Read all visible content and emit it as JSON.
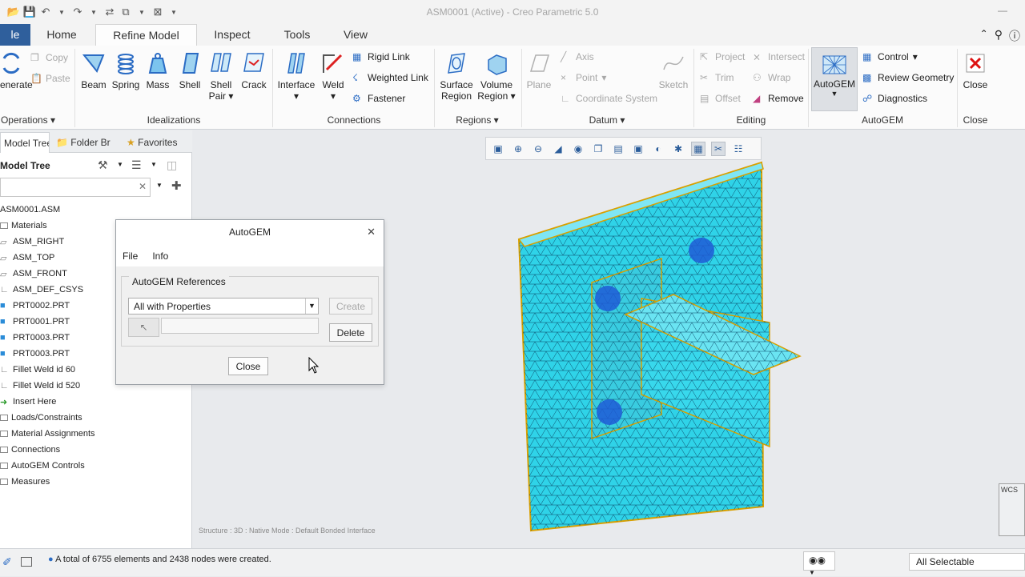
{
  "window": {
    "title": "ASM0001 (Active) - Creo Parametric 5.0"
  },
  "qat": {
    "icons": [
      "open-icon",
      "save-icon",
      "undo-icon",
      "redo-icon",
      "regenerate-icon",
      "windows-icon",
      "close-window-icon",
      "customize-icon"
    ]
  },
  "tabs": [
    {
      "label": "le"
    },
    {
      "label": "Home"
    },
    {
      "label": "Refine Model"
    },
    {
      "label": "Inspect"
    },
    {
      "label": "Tools"
    },
    {
      "label": "View"
    }
  ],
  "ribbon": {
    "operations": {
      "regen_label": "enerate",
      "copy": "Copy",
      "paste": "Paste",
      "group": "Operations"
    },
    "idealizations": {
      "beam": "Beam",
      "spring": "Spring",
      "mass": "Mass",
      "shell": "Shell",
      "shell_pair_1": "Shell",
      "shell_pair_2": "Pair",
      "crack": "Crack",
      "group": "Idealizations"
    },
    "connections": {
      "interface": "Interface",
      "weld": "Weld",
      "rigid_link": "Rigid Link",
      "weighted_link": "Weighted Link",
      "fastener": "Fastener",
      "group": "Connections"
    },
    "regions": {
      "surface_1": "Surface",
      "surface_2": "Region",
      "volume_1": "Volume",
      "volume_2": "Region",
      "group": "Regions"
    },
    "datum": {
      "plane": "Plane",
      "axis": "Axis",
      "point": "Point",
      "csys": "Coordinate System",
      "sketch": "Sketch",
      "group": "Datum"
    },
    "editing": {
      "project": "Project",
      "trim": "Trim",
      "offset": "Offset",
      "intersect": "Intersect",
      "wrap": "Wrap",
      "remove": "Remove",
      "group": "Editing"
    },
    "autogem": {
      "autogem": "AutoGEM",
      "control": "Control",
      "review": "Review Geometry",
      "diagnostics": "Diagnostics",
      "group": "AutoGEM"
    },
    "close": {
      "close": "Close",
      "group": "Close"
    }
  },
  "leftpanel": {
    "tabs": [
      "Model Tree",
      "Folder Br",
      "Favorites"
    ],
    "title": "Model Tree",
    "tree": [
      "ASM0001.ASM",
      "Materials",
      "ASM_RIGHT",
      "ASM_TOP",
      "ASM_FRONT",
      "ASM_DEF_CSYS",
      "PRT0002.PRT",
      "PRT0001.PRT",
      "PRT0003.PRT",
      "PRT0003.PRT",
      "Fillet Weld id 60",
      "Fillet Weld id 520",
      "Insert Here",
      "Loads/Constraints",
      "Material Assignments",
      "Connections",
      "AutoGEM Controls",
      "Measures"
    ]
  },
  "dialog": {
    "title": "AutoGEM",
    "menu_file": "File",
    "menu_info": "Info",
    "legend": "AutoGEM References",
    "select_value": "All with Properties",
    "create": "Create",
    "delete": "Delete",
    "close": "Close"
  },
  "graphics": {
    "structure_text": "Structure : 3D : Native Mode : Default Bonded Interface",
    "wcs_label": "WCS",
    "mesh_color": "#2fd3e8",
    "node_color": "#f0b000",
    "bolt_color": "#1f5bd6"
  },
  "status": {
    "message": "A total of 6755 elements and 2438 nodes were created.",
    "filter": "All Selectable"
  }
}
